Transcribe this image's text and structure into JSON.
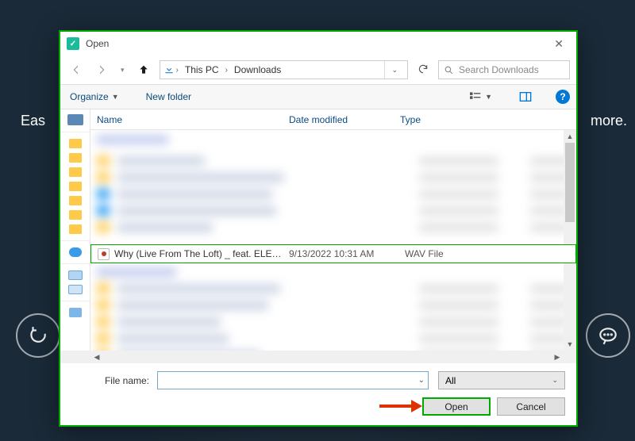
{
  "background": {
    "left_text": "Eas",
    "right_text": "more."
  },
  "dialog": {
    "title": "Open",
    "breadcrumb": {
      "root": "This PC",
      "folder": "Downloads"
    },
    "search_placeholder": "Search Downloads",
    "toolbar": {
      "organize": "Organize",
      "new_folder": "New folder"
    },
    "columns": {
      "name": "Name",
      "date": "Date modified",
      "type": "Type"
    },
    "selected_file": {
      "name": "Why (Live From The Loft) _ feat. ELEVATI...",
      "date": "9/13/2022 10:31 AM",
      "type": "WAV File"
    },
    "footer": {
      "file_name_label": "File name:",
      "file_name_value": "",
      "filter": "All",
      "open": "Open",
      "cancel": "Cancel"
    }
  }
}
